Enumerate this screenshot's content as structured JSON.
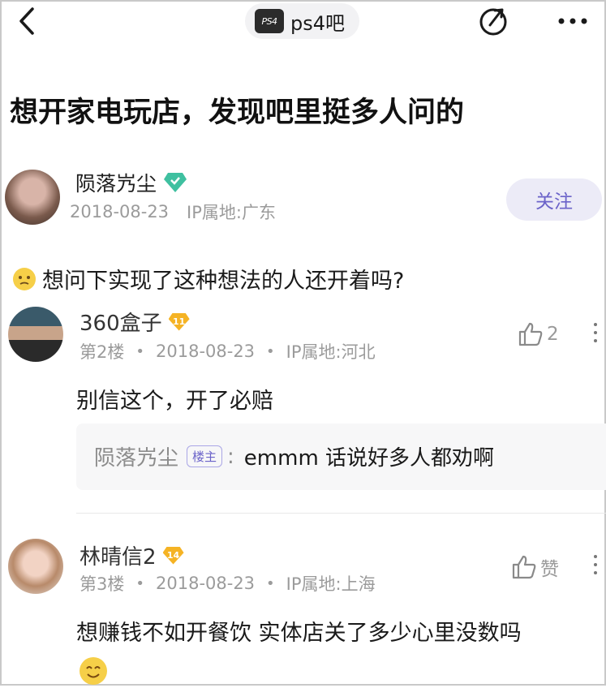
{
  "topbar": {
    "forum_name": "ps4吧",
    "forum_logo_text": "PS4"
  },
  "post": {
    "title": "想开家电玩店，发现吧里挺多人问的",
    "author": {
      "name": "陨落㞧尘",
      "date": "2018-08-23",
      "ip": "IP属地:广东"
    },
    "follow_label": "关注",
    "text": "想问下实现了这种想法的人还开着吗?"
  },
  "comments": [
    {
      "name": "360盒子",
      "level": "11",
      "floor": "第2楼",
      "date": "2018-08-23",
      "ip": "IP属地:河北",
      "likes": "2",
      "text": "别信这个，开了必赔",
      "reply": {
        "user": "陨落㞧尘",
        "tag": "楼主",
        "colon": ":",
        "text": "emmm 话说好多人都劝啊"
      }
    },
    {
      "name": "林晴信2",
      "level": "14",
      "floor": "第3楼",
      "date": "2018-08-23",
      "ip": "IP属地:上海",
      "likes": "赞",
      "text": "想赚钱不如开餐饮 实体店关了多少心里没数吗"
    }
  ],
  "meta_sep": "•",
  "icons": [
    "back-icon",
    "share-icon",
    "more-icon",
    "verified-icon",
    "level-badge-icon",
    "thumbs-up-icon",
    "kebab-icon",
    "emoji-icon"
  ],
  "colors": {
    "accent": "#6b63c9",
    "follow_bg": "#ecebf7",
    "verified": "#3fc0a0",
    "level": "#f5b324",
    "meta": "#9b9b9b"
  }
}
